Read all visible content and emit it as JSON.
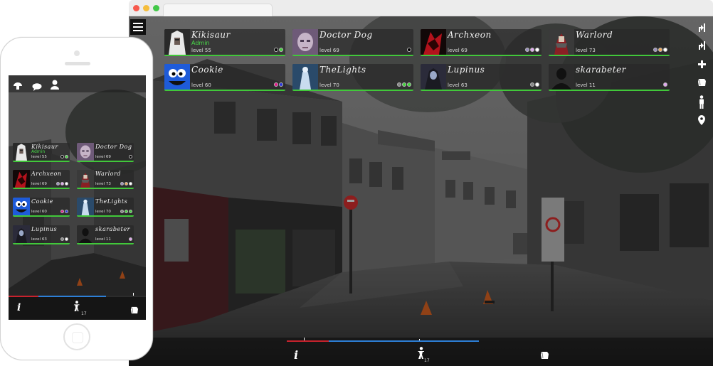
{
  "players": [
    {
      "name": "Kikisaur",
      "role": "Admin",
      "level": "level 55",
      "avatar": "white-hair-character-avatar",
      "status_colors": [
        "#000000",
        "#43d33c"
      ]
    },
    {
      "name": "Doctor Dog",
      "role": "",
      "level": "level 69",
      "avatar": "pale-face-avatar",
      "status_colors": [
        "#000000"
      ]
    },
    {
      "name": "Archxeon",
      "role": "",
      "level": "level 69",
      "avatar": "red-black-demon-avatar",
      "status_colors": [
        "#9a8fbf",
        "#e0a5f0",
        "#ffffff"
      ]
    },
    {
      "name": "Warlord",
      "role": "",
      "level": "level 73",
      "avatar": "red-armored-warrior-avatar",
      "status_colors": [
        "#9a8fbf",
        "#f0a855",
        "#ffffff"
      ]
    },
    {
      "name": "Cookie",
      "role": "",
      "level": "level 60",
      "avatar": "blue-monster-avatar",
      "status_colors": [
        "#e01a8a",
        "#2a35d8"
      ]
    },
    {
      "name": "TheLights",
      "role": "",
      "level": "level 70",
      "avatar": "ghostly-blue-figure-avatar",
      "status_colors": [
        "#888888",
        "#43d33c",
        "#43d33c"
      ]
    },
    {
      "name": "Lupinus",
      "role": "",
      "level": "level 63",
      "avatar": "dark-hooded-figure-avatar",
      "status_colors": [
        "#888888",
        "#ffffff"
      ]
    },
    {
      "name": "skarabeter",
      "role": "",
      "level": "level 11",
      "avatar": "default-silhouette-avatar",
      "status_colors": [
        "#e0a5f0"
      ]
    }
  ],
  "bottom_bar": {
    "info_label": "i",
    "steps_count": "17",
    "progress_red_fraction": 0.22,
    "progress_blue_fraction": 1.0
  },
  "sidebar_icons": [
    "vote-arrow-up-icon",
    "vote-arrow-down-icon",
    "plus-icon",
    "map-stone-icon",
    "person-standing-icon",
    "location-pin-icon"
  ],
  "mobile_header_icons": [
    "mushroom-icon",
    "chat-bubble-icon",
    "user-icon"
  ],
  "colors": {
    "accent_green": "#41c83a",
    "progress_blue": "#2d7fd6",
    "progress_red": "#c7222d"
  }
}
